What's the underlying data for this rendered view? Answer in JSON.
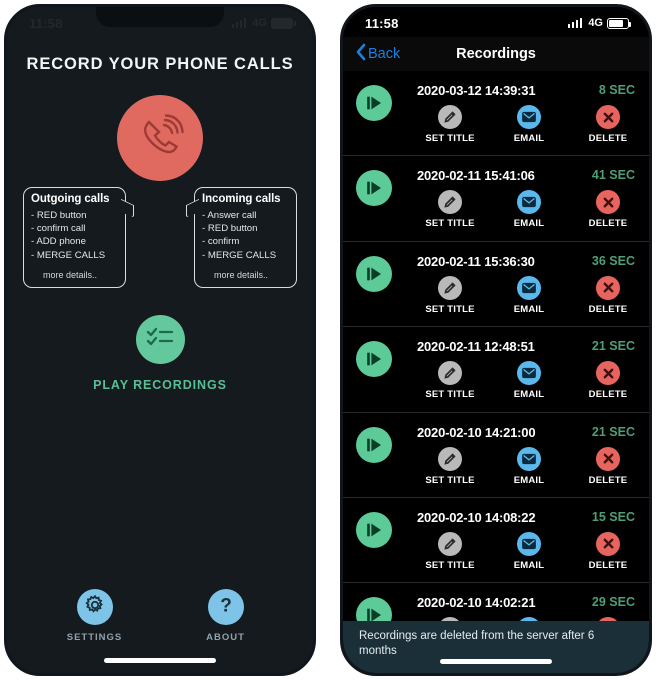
{
  "home_screen": {
    "status_bar": {
      "time": "11:58",
      "network": "4G",
      "signal_icon": "signal-bars-icon",
      "battery_icon": "battery-icon"
    },
    "title": "RECORD YOUR PHONE CALLS",
    "record_button": {
      "icon": "phone-handset-icon",
      "color": "#e06a5f"
    },
    "callouts": [
      {
        "heading": "Outgoing calls",
        "steps": [
          "- RED button",
          "- confirm call",
          "- ADD phone",
          "- MERGE CALLS"
        ],
        "more_label": "more details.."
      },
      {
        "heading": "Incoming calls",
        "steps": [
          "- Answer call",
          "- RED button",
          "- confirm",
          "- MERGE CALLS"
        ],
        "more_label": "more details.."
      }
    ],
    "play_recordings": {
      "label": "PLAY RECORDINGS",
      "icon": "checklist-icon",
      "color": "#63c89b"
    },
    "tabs": [
      {
        "label": "SETTINGS",
        "icon": "gear-icon",
        "color": "#7ec4e8"
      },
      {
        "label": "ABOUT",
        "icon": "question-mark-icon",
        "color": "#7ec4e8"
      }
    ]
  },
  "recordings_screen": {
    "status_bar": {
      "time": "11:58",
      "network": "4G",
      "signal_icon": "signal-bars-icon",
      "battery_icon": "battery-icon"
    },
    "nav": {
      "back_label": "Back",
      "back_icon": "chevron-left-icon",
      "title": "Recordings",
      "accent_color": "#1b7fe0"
    },
    "action_labels": {
      "set_title": "SET TITLE",
      "email": "EMAIL",
      "delete": "DELETE"
    },
    "action_icons": {
      "set_title": "pencil-icon",
      "email": "envelope-icon",
      "delete": "close-x-icon",
      "play": "play-icon"
    },
    "rows": [
      {
        "date": "2020-03-12 14:39:31",
        "duration": "8 SEC"
      },
      {
        "date": "2020-02-11 15:41:06",
        "duration": "41 SEC"
      },
      {
        "date": "2020-02-11 15:36:30",
        "duration": "36 SEC"
      },
      {
        "date": "2020-02-11 12:48:51",
        "duration": "21 SEC"
      },
      {
        "date": "2020-02-10 14:21:00",
        "duration": "21 SEC"
      },
      {
        "date": "2020-02-10 14:08:22",
        "duration": "15 SEC"
      },
      {
        "date": "2020-02-10 14:02:21",
        "duration": "29 SEC"
      }
    ],
    "banner": {
      "text": "Recordings are deleted from the server after 6 months",
      "color": "#1b2f38"
    }
  }
}
